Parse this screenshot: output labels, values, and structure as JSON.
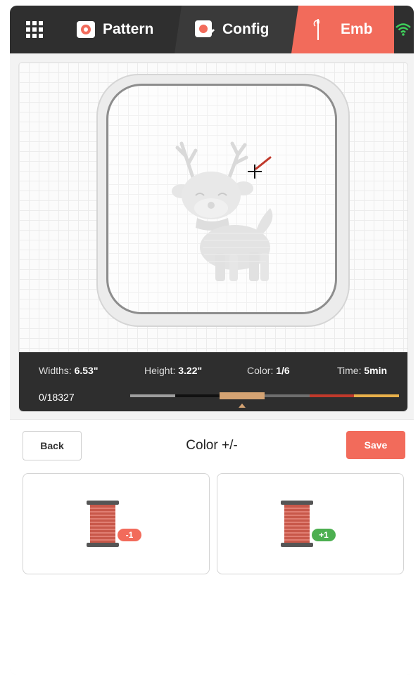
{
  "nav": {
    "menu_icon": "grid-menu-icon",
    "tabs": [
      {
        "label": "Pattern",
        "icon": "pattern-icon"
      },
      {
        "label": "Config",
        "icon": "config-icon"
      },
      {
        "label": "Emb",
        "icon": "needle-icon"
      }
    ],
    "status_icon": "wifi-icon",
    "colors": {
      "bar": "#2f2f2f",
      "active": "#f26b5b",
      "wifi": "#3ecf5a"
    }
  },
  "stats": {
    "width_label": "Widths: ",
    "width_value": "6.53\"",
    "height_label": "Height: ",
    "height_value": "3.22\"",
    "color_label": "Color: ",
    "color_value": "1/6",
    "time_label": "Time: ",
    "time_value": "5min",
    "stitch_count": "0/18327",
    "thread_colors": [
      "#9e9e9e",
      "#111111",
      "#d4a373",
      "#6e6e6e",
      "#c0392b",
      "#e8b04a"
    ],
    "active_color_index": 2
  },
  "panel": {
    "back_label": "Back",
    "title": "Color +/-",
    "save_label": "Save",
    "minus_badge": "-1",
    "plus_badge": "+1"
  }
}
